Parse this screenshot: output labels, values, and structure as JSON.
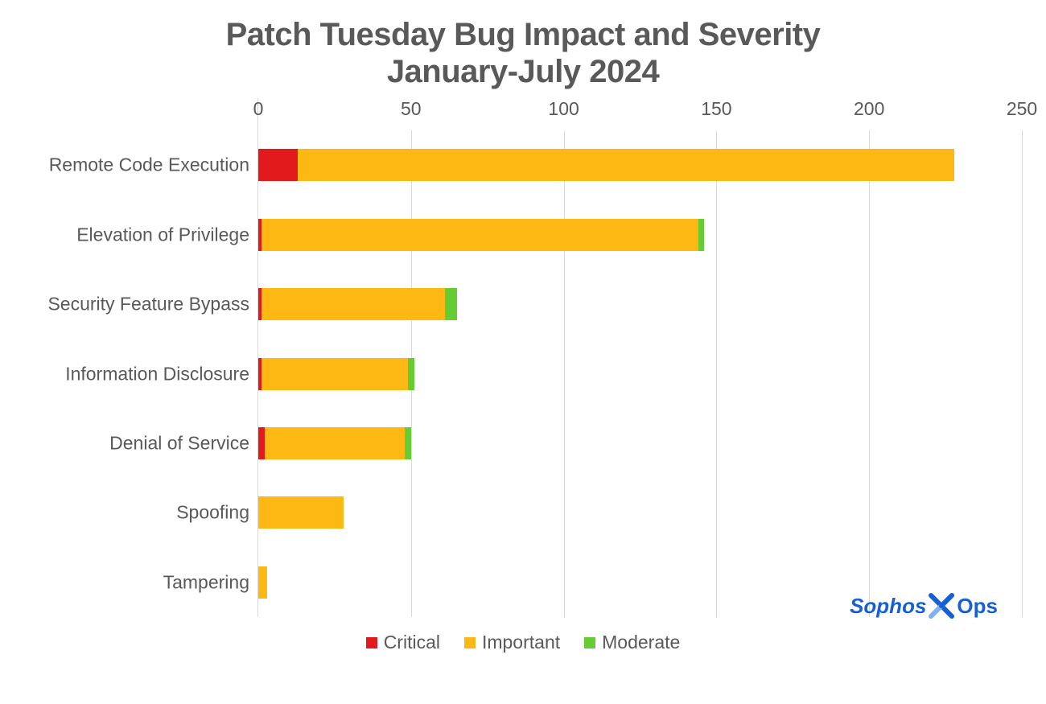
{
  "chart_data": {
    "type": "bar",
    "orientation": "horizontal",
    "stacked": true,
    "title": "Patch Tuesday Bug Impact and Severity\nJanuary-July 2024",
    "xlabel": "",
    "ylabel": "",
    "xlim": [
      0,
      250
    ],
    "x_ticks": [
      0,
      50,
      100,
      150,
      200,
      250
    ],
    "categories": [
      "Remote Code Execution",
      "Elevation of Privilege",
      "Security Feature Bypass",
      "Information Disclosure",
      "Denial of Service",
      "Spoofing",
      "Tampering"
    ],
    "series": [
      {
        "name": "Critical",
        "color": "#e31a1c",
        "values": [
          13,
          1,
          1,
          1,
          2,
          0,
          0
        ]
      },
      {
        "name": "Important",
        "color": "#fdb813",
        "values": [
          215,
          143,
          60,
          48,
          46,
          28,
          3
        ]
      },
      {
        "name": "Moderate",
        "color": "#66cc33",
        "values": [
          0,
          2,
          4,
          2,
          2,
          0,
          0
        ]
      }
    ],
    "legend_position": "bottom",
    "grid": true
  },
  "title_line1": "Patch Tuesday Bug Impact and Severity",
  "title_line2": "January-July 2024",
  "legend": {
    "critical": "Critical",
    "important": "Important",
    "moderate": "Moderate"
  },
  "brand": {
    "left": "Sophos",
    "right": "Ops"
  },
  "ticks": {
    "t0": "0",
    "t1": "50",
    "t2": "100",
    "t3": "150",
    "t4": "200",
    "t5": "250"
  },
  "cats": {
    "c0": "Remote Code Execution",
    "c1": "Elevation of Privilege",
    "c2": "Security Feature Bypass",
    "c3": "Information Disclosure",
    "c4": "Denial of Service",
    "c5": "Spoofing",
    "c6": "Tampering"
  }
}
